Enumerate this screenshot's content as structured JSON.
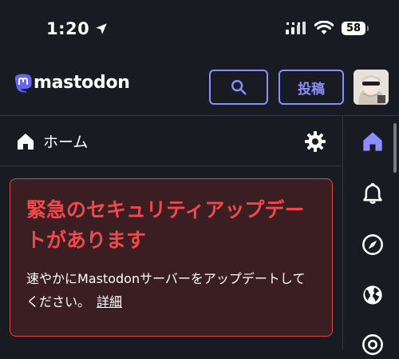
{
  "status_bar": {
    "time": "1:20",
    "battery": "58",
    "icons": [
      "location-arrow-icon",
      "signal-icon",
      "wifi-icon",
      "battery-icon"
    ]
  },
  "header": {
    "logo_text": "mastodon",
    "search_icon": "search-icon",
    "post_label": "投稿",
    "accent_color": "#8c8dff"
  },
  "column": {
    "title": "ホーム",
    "home_icon": "home-icon",
    "settings_icon": "gear-icon"
  },
  "alert": {
    "title": "緊急のセキュリティアップデートがあります",
    "body": "速やかにMastodonサーバーをアップデートしてください。",
    "link": "詳細",
    "color": "#f0484d"
  },
  "side_nav": {
    "items": [
      "home-icon",
      "bell-icon",
      "compass-icon",
      "globe-icon",
      "at-icon"
    ],
    "active_color": "#8c8dff"
  }
}
